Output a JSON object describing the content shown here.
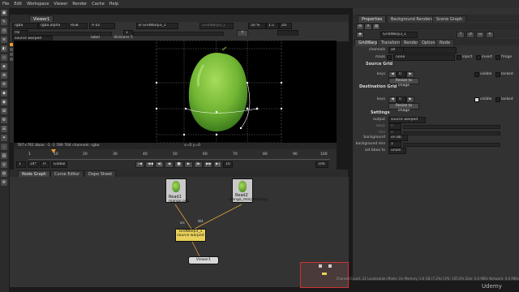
{
  "menu": [
    "File",
    "Edit",
    "Workspace",
    "Viewer",
    "Render",
    "Cache",
    "Help"
  ],
  "viewer": {
    "tab": "Viewer1",
    "channels": "rgba",
    "alpha": "rgba.alpha",
    "colorspace": "RGB",
    "input_a": "A  02",
    "input_b": "B  GridWarp3_1",
    "input_c": "GridWarp3_1",
    "zoom": "50 %",
    "ratio": "1:1",
    "view_mode": "2D",
    "gain": "f/8",
    "gamma": "1",
    "y_val": "Y",
    "mode": "source warped",
    "label": "label",
    "divisions": "divisions  5",
    "status_text": "787×761  bbox: -1 -1 789 764 channels: rgba",
    "coords": "x=0 y=0"
  },
  "timeline": {
    "ticks": [
      "1",
      "10",
      "20",
      "30",
      "40",
      "50",
      "60",
      "70",
      "80",
      "90",
      "100"
    ],
    "frame": "1",
    "fps": "24*",
    "mode": "TF",
    "global": "Global",
    "step": "10",
    "end": "100"
  },
  "node_tabs": [
    "Node Graph",
    "Curve Editor",
    "Dope Sheet"
  ],
  "nodes": {
    "read1": {
      "label": "Read1",
      "file": "mango.png"
    },
    "read2": {
      "label": "Read2",
      "file": "mango_morphed.png"
    },
    "gridwarp": {
      "label": "GridWarp3_1",
      "sub": "source warped",
      "src": "src",
      "dst": "dst"
    },
    "viewer": {
      "label": "Viewer1"
    }
  },
  "props_tabs": [
    "Properties",
    "Background Renders",
    "Scene Graph"
  ],
  "props": {
    "node_tab": "GridWarp3_2",
    "node_name": "GridWarp3_1",
    "subtabs": [
      "GridWarp",
      "Transform",
      "Render",
      "Options",
      "Node"
    ],
    "channels_label": "channels",
    "channels_value": "all",
    "mask_label": "mask",
    "mask_value": "none",
    "inject": "inject",
    "invert": "invert",
    "fringe": "fringe",
    "source_grid": "Source Grid",
    "keys_label": "keys",
    "keys_value": "0",
    "visible": "visible",
    "locked": "locked",
    "reset_image": "Resize to image",
    "dest_grid": "Destination Grid",
    "settings": "Settings",
    "output_label": "output",
    "output_value": "source warped",
    "warp_label": "warp",
    "warp_value": "0",
    "mix_label": "mix",
    "mix_value": "0",
    "background_label": "background",
    "background_value": "on bb",
    "bg_mix_label": "background mix",
    "bg_mix_value": "1",
    "bbox_label": "set bbox to",
    "bbox_value": "union"
  },
  "status_bar": "Channel Count: 22  Localization Mode: On  Memory: 2.6 GB (7.2%)  CPU: 105.0%  Disk: 0.0 MB/s  Network: 0.0 MB/s",
  "watermark": "Udemy",
  "colors": {
    "accent": "#e89a2c",
    "mango_green": "#7cc23a",
    "node_read": "#c9c9c9",
    "node_selected": "#e8d05a",
    "edge": "#e0a040"
  }
}
